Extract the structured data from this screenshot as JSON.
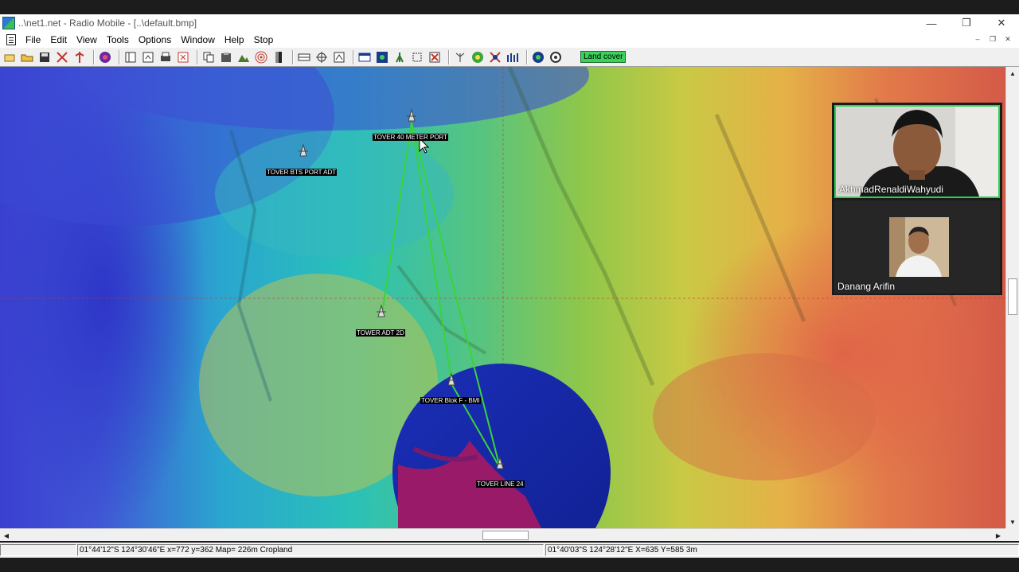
{
  "window": {
    "title": "..\\net1.net - Radio Mobile - [..\\default.bmp]",
    "controls": [
      "—",
      "❐",
      "✕"
    ]
  },
  "menu": {
    "items": [
      "File",
      "Edit",
      "View",
      "Tools",
      "Options",
      "Window",
      "Help",
      "Stop"
    ],
    "mdi_controls": [
      "–",
      "❐",
      "✕"
    ]
  },
  "toolbar": {
    "land_cover_label": "Land cover"
  },
  "map": {
    "towers": [
      {
        "label": "TOVER 40 METER PORT"
      },
      {
        "label": "TOVER BTS PORT ADT"
      },
      {
        "label": "TOWER ADT 2D"
      },
      {
        "label": "TOVER Blok F - BMI"
      },
      {
        "label": "TOVER LINE 24"
      }
    ]
  },
  "status": {
    "cursor_info": "01°44'12\"S  124°30'46\"E   x=772 y=362 Map= 226m Cropland",
    "selected_info": "01°40'03\"S 124°28'12\"E  X=635 Y=585 3m"
  },
  "video_call": {
    "participants": [
      {
        "name": "AkhmadRenaldiWahyudi"
      },
      {
        "name": "Danang Arifin"
      }
    ]
  }
}
